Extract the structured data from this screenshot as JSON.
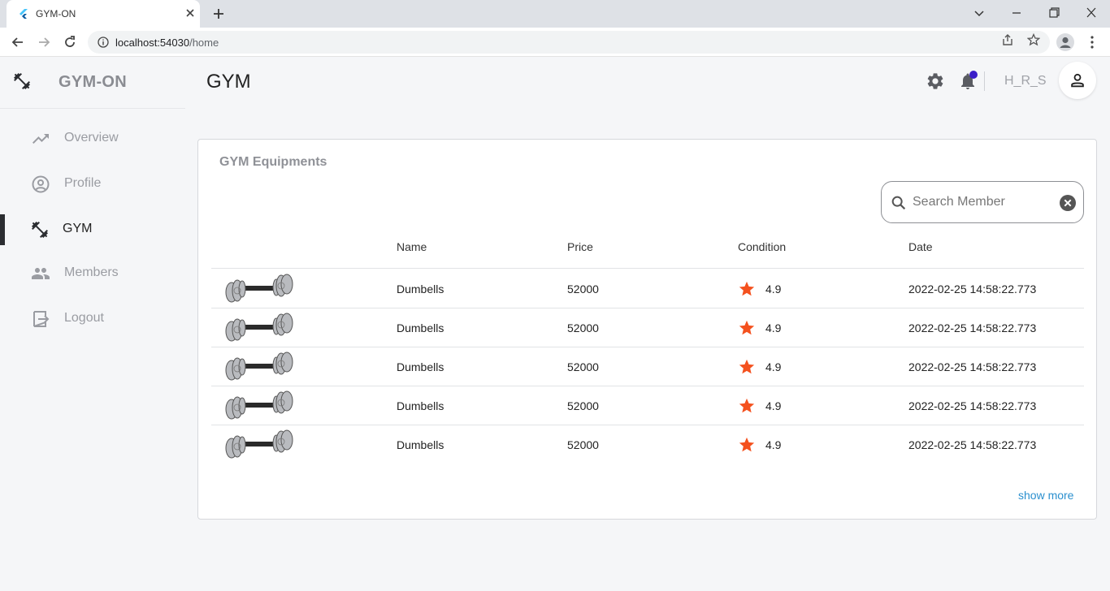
{
  "browser": {
    "tab_title": "GYM-ON",
    "url_host": "localhost:54030",
    "url_path": "/home"
  },
  "app": {
    "brand_name": "GYM-ON",
    "page_title": "GYM",
    "username": "H_R_S",
    "accent_color": "#3b1ec8"
  },
  "sidebar": {
    "items": [
      {
        "label": "Overview",
        "icon": "trending-up-icon"
      },
      {
        "label": "Profile",
        "icon": "account-circle-icon"
      },
      {
        "label": "GYM",
        "icon": "fitness-icon",
        "active": true
      },
      {
        "label": "Members",
        "icon": "people-icon"
      },
      {
        "label": "Logout",
        "icon": "logout-icon"
      }
    ]
  },
  "card": {
    "title": "GYM Equipments",
    "search_placeholder": "Search Member",
    "columns": [
      "Name",
      "Price",
      "Condition",
      "Date"
    ],
    "rows": [
      {
        "name": "Dumbells",
        "price": "52000",
        "rating": "4.9",
        "date": "2022-02-25 14:58:22.773"
      },
      {
        "name": "Dumbells",
        "price": "52000",
        "rating": "4.9",
        "date": "2022-02-25 14:58:22.773"
      },
      {
        "name": "Dumbells",
        "price": "52000",
        "rating": "4.9",
        "date": "2022-02-25 14:58:22.773"
      },
      {
        "name": "Dumbells",
        "price": "52000",
        "rating": "4.9",
        "date": "2022-02-25 14:58:22.773"
      },
      {
        "name": "Dumbells",
        "price": "52000",
        "rating": "4.9",
        "date": "2022-02-25 14:58:22.773"
      }
    ],
    "show_more": "show more",
    "star_color": "#f4511e"
  }
}
